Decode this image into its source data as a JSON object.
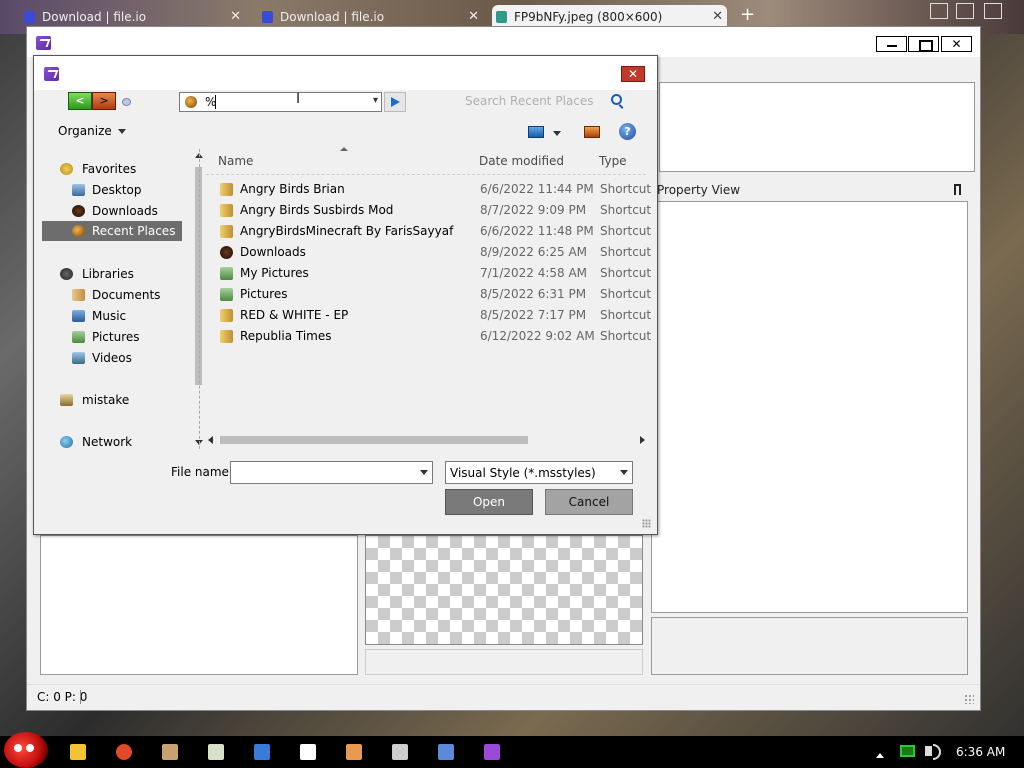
{
  "browser": {
    "tabs": [
      {
        "label": "Download | file.io"
      },
      {
        "label": "Download | file.io"
      },
      {
        "label": "FP9bNFy.jpeg (800×600)"
      }
    ],
    "tab_close_glyph": "✕",
    "new_tab_glyph": "+"
  },
  "app": {
    "window_controls": {
      "close_glyph": "✕"
    },
    "property_view_label": "Property View",
    "status_text": "C: 0 P: 0"
  },
  "dialog": {
    "close_glyph": "✕",
    "nav": {
      "back_glyph": "<",
      "forward_glyph": ">"
    },
    "address_value": "%",
    "address_dropdown_glyph": "▾",
    "search_placeholder": "Search Recent Places",
    "organize_label": "Organize",
    "help_glyph": "?",
    "nav_pane": {
      "favorites": {
        "label": "Favorites",
        "items": [
          "Desktop",
          "Downloads",
          "Recent Places"
        ]
      },
      "libraries": {
        "label": "Libraries",
        "items": [
          "Documents",
          "Music",
          "Pictures",
          "Videos"
        ]
      },
      "user": "mistake",
      "network": "Network"
    },
    "columns": {
      "name": "Name",
      "date": "Date modified",
      "type": "Type"
    },
    "files": [
      {
        "name": "Angry Birds Brian",
        "date": "6/6/2022 11:44 PM",
        "type": "Shortcut"
      },
      {
        "name": "Angry Birds Susbirds Mod",
        "date": "8/7/2022 9:09 PM",
        "type": "Shortcut"
      },
      {
        "name": "AngryBirdsMinecraft By FarisSayyaf",
        "date": "6/6/2022 11:48 PM",
        "type": "Shortcut"
      },
      {
        "name": "Downloads",
        "date": "8/9/2022 6:25 AM",
        "type": "Shortcut"
      },
      {
        "name": "My Pictures",
        "date": "7/1/2022 4:58 AM",
        "type": "Shortcut"
      },
      {
        "name": "Pictures",
        "date": "8/5/2022 6:31 PM",
        "type": "Shortcut"
      },
      {
        "name": "RED & WHITE - EP",
        "date": "8/5/2022 7:17 PM",
        "type": "Shortcut"
      },
      {
        "name": "Republia Times",
        "date": "6/12/2022 9:02 AM",
        "type": "Shortcut"
      }
    ],
    "filename_label": "File name:",
    "filename_value": "",
    "filetype_value": "Visual Style (*.msstyles)",
    "open_label": "Open",
    "cancel_label": "Cancel"
  },
  "taskbar": {
    "clock": "6:36 AM",
    "icon_colors": [
      "#f2c431",
      "#e04a2a",
      "#c9a070",
      "#d8e0c8",
      "#3a7ad8",
      "#ffffff",
      "#e89a50",
      "#cccccc",
      "#5a8ad8",
      "#9a4ad8"
    ]
  },
  "colors": {
    "selection": "#6d6d6d",
    "dialog_close": "#c0392b",
    "accent_blue": "#1e6ed0"
  }
}
